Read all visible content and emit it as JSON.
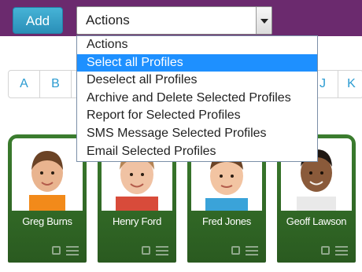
{
  "toolbar": {
    "add_label": "Add",
    "actions_value": "Actions"
  },
  "dropdown": {
    "options": [
      "Actions",
      "Select all Profiles",
      "Deselect all Profiles",
      "Archive and Delete Selected Profiles",
      "Report for Selected Profiles",
      "SMS Message Selected Profiles",
      "Email Selected Profiles"
    ],
    "highlighted": "Select all Profiles"
  },
  "letters": [
    "A",
    "B",
    "J",
    "K"
  ],
  "profiles": [
    {
      "name": "Greg Burns"
    },
    {
      "name": "Henry Ford"
    },
    {
      "name": "Fred Jones"
    },
    {
      "name": "Geoff Lawson"
    }
  ],
  "colors": {
    "topbar": "#6b2a6e",
    "add_button": "#2a9bd1",
    "card_green": "#3b7d2e",
    "highlight": "#1e90ff"
  }
}
